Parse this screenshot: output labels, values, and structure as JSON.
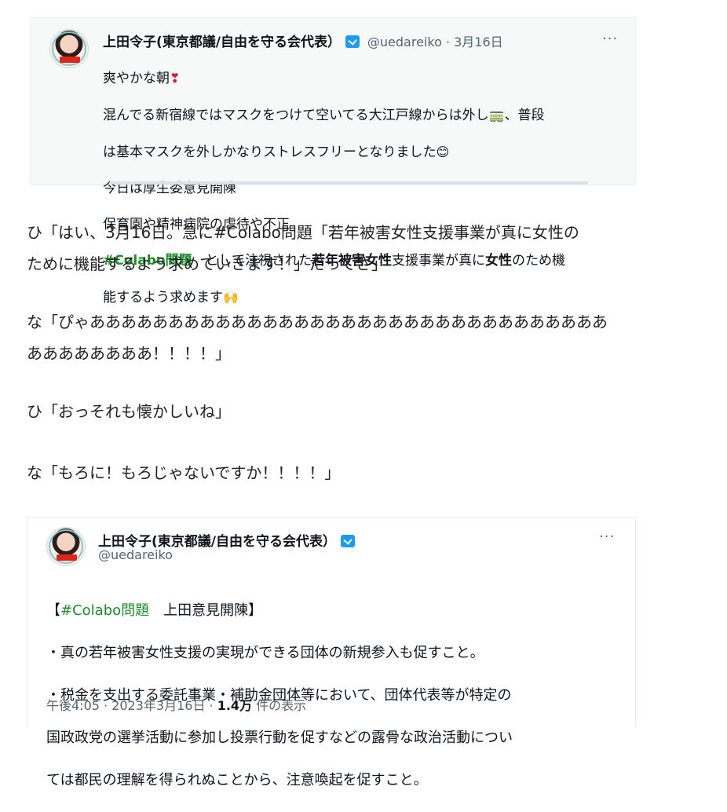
{
  "tweet1": {
    "author": "上田令子(東京都議/自由を守る会代表）",
    "handle_date": "@uedareiko · 3月16日",
    "more_label": "···",
    "line1": "爽やかな朝",
    "line1_emoji": "❣",
    "line2a": "混んでる新宿線ではマスクをつけて空いてる大江戸線からは外し",
    "line2_emoji": "🚃",
    "line2b": "、普段",
    "line3a": "は基本マスクを外しかなりストレスフリーとなりました",
    "line3_emoji": "😊",
    "line4": "今日は厚生委意見開陳",
    "line5": "保育園や精神病院の虐待や不正",
    "line6_hashtag": "#Colabo問題",
    "line6_a": "　として注視された",
    "line6_bold1": "若年被害女性",
    "line6_b": "支援事業が真に",
    "line6_bold2": "女性",
    "line6_c": "のため機",
    "line7": "能するよう求めます",
    "line7_emoji": "🙌"
  },
  "dialogue": [
    {
      "line1": "ひ「はい、3月16日。急に#Colabo問題「若年被害女性支援事業が真に女性の",
      "line2": "ために機能するよう求めていきます！」だってさ」"
    },
    {
      "line1": "な「ぴゃあああああああああああああああああああああああああああああああああ",
      "line2": "ああああああああ！！！！」"
    },
    {
      "line1": "ひ「おっそれも懐かしいね」"
    },
    {
      "line1": "な「もろに！もろじゃないですか！！！！」"
    }
  ],
  "tweet2": {
    "author": "上田令子(東京都議/自由を守る会代表）",
    "handle": "@uedareiko",
    "more_label": "···",
    "line1_open": "【",
    "line1_hashtag": "#Colabo問題",
    "line1_rest": "　上田意見開陳】",
    "line2": "・真の若年被害女性支援の実現ができる団体の新規参入も促すこと。",
    "line3": "・税金を支出する委託事業・補助金団体等において、団体代表等が特定の",
    "line4": "国政政党の選挙活動に参加し投票行動を促すなどの露骨な政治活動につい",
    "line5": "ては都民の理解を得られぬことから、注意喚起を促すこと。",
    "meta_time": "午後4:05 · 2023年3月16日 · ",
    "meta_views": "1.4万",
    "meta_views_label": " 件の表示"
  },
  "colors": {
    "hashtag": "#1a8d2a",
    "verified": "#1d9bf0",
    "muted": "#536471"
  }
}
